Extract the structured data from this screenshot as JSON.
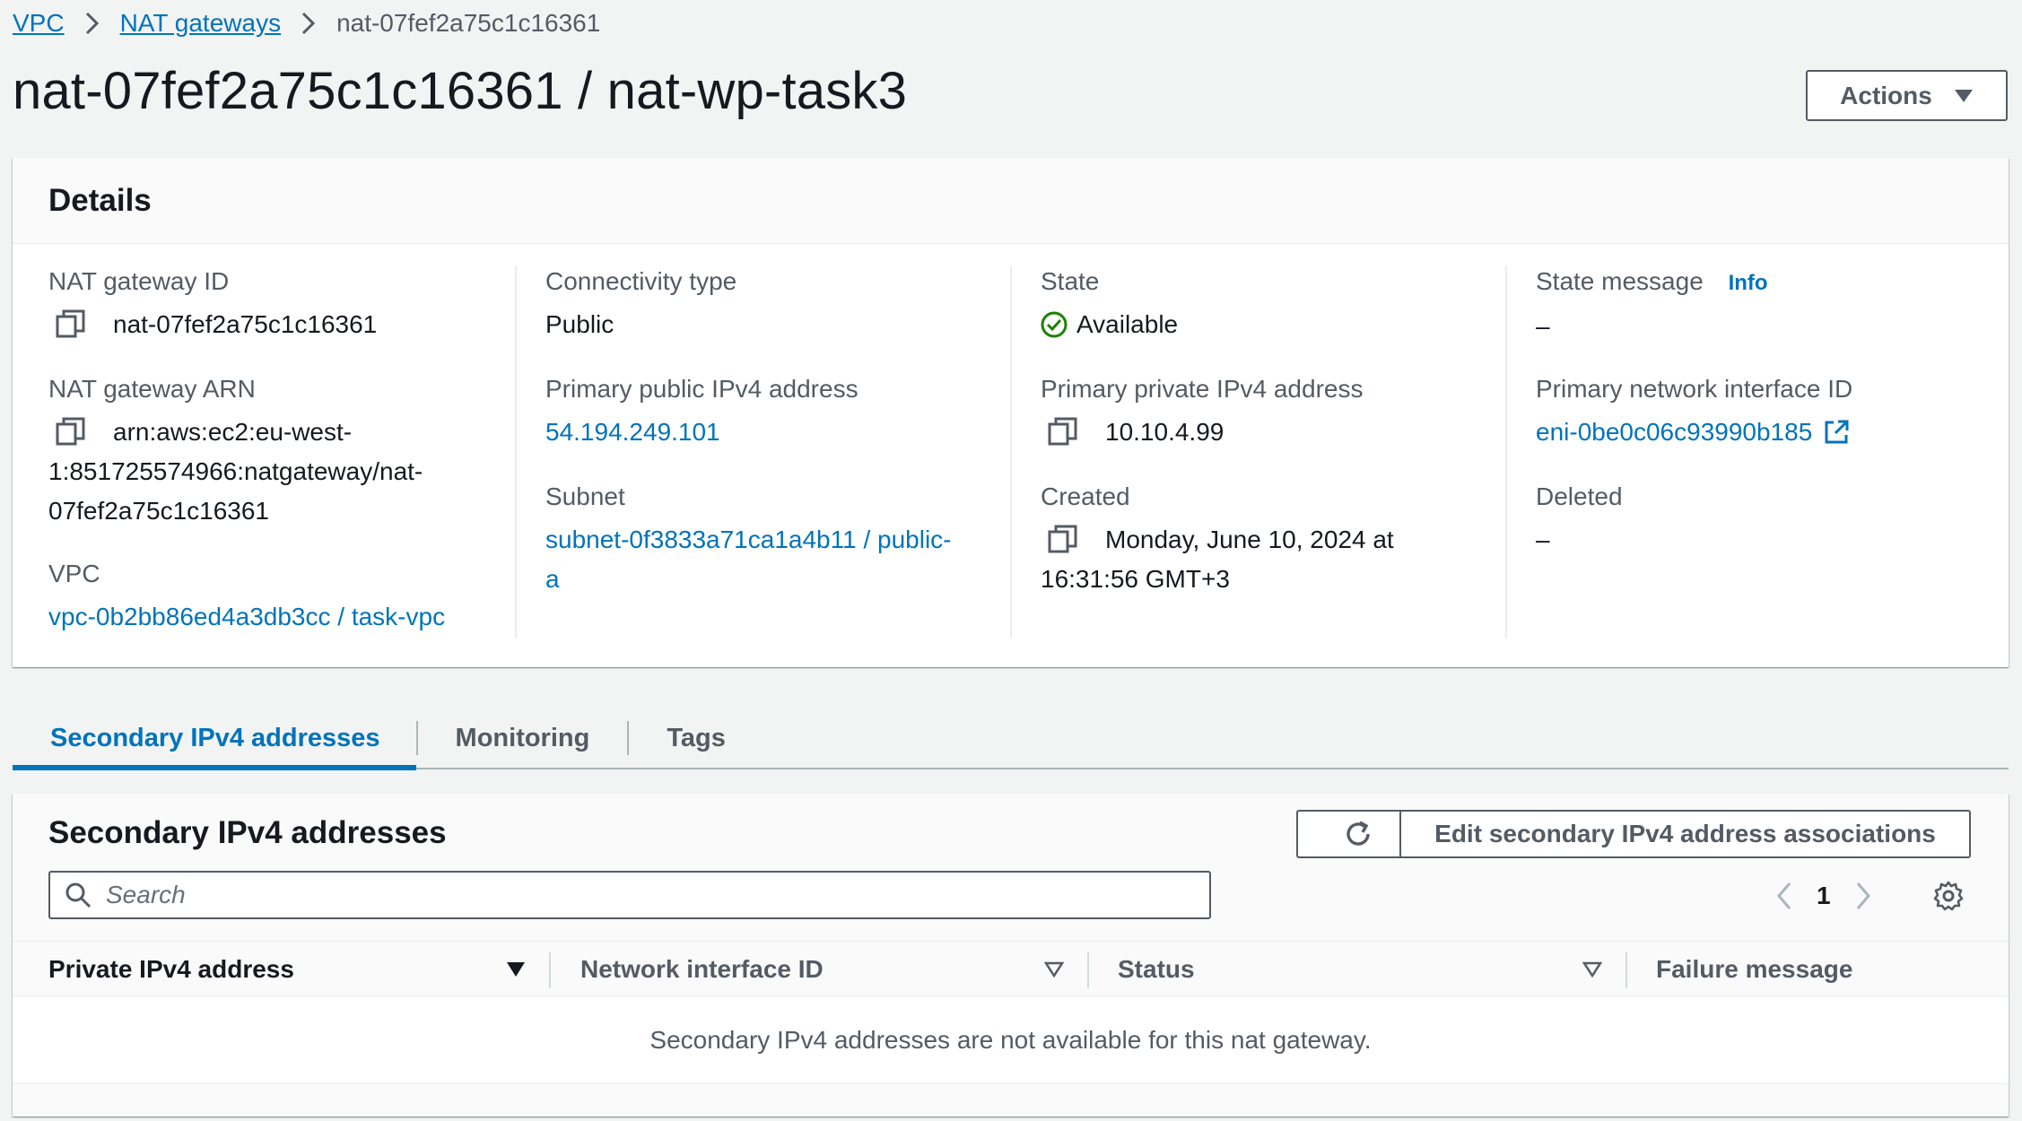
{
  "breadcrumb": {
    "items": [
      "VPC",
      "NAT gateways"
    ],
    "current": "nat-07fef2a75c1c16361"
  },
  "header": {
    "title": "nat-07fef2a75c1c16361 / nat-wp-task3",
    "actions_label": "Actions"
  },
  "details": {
    "title": "Details",
    "nat_gateway_id": {
      "label": "NAT gateway ID",
      "value": "nat-07fef2a75c1c16361"
    },
    "nat_gateway_arn": {
      "label": "NAT gateway ARN",
      "line1": "arn:aws:ec2:eu-west-",
      "line2": "1:851725574966:natgateway/nat-",
      "line3": "07fef2a75c1c16361"
    },
    "vpc": {
      "label": "VPC",
      "value": "vpc-0b2bb86ed4a3db3cc / task-vpc"
    },
    "connectivity_type": {
      "label": "Connectivity type",
      "value": "Public"
    },
    "primary_public_ip": {
      "label": "Primary public IPv4 address",
      "value": "54.194.249.101"
    },
    "subnet": {
      "label": "Subnet",
      "line1": "subnet-0f3833a71ca1a4b11 / public-",
      "line2": "a"
    },
    "state": {
      "label": "State",
      "value": "Available"
    },
    "primary_private_ip": {
      "label": "Primary private IPv4 address",
      "value": "10.10.4.99"
    },
    "created": {
      "label": "Created",
      "line1": "Monday, June 10, 2024 at",
      "line2": "16:31:56 GMT+3"
    },
    "state_message": {
      "label": "State message",
      "info": "Info",
      "value": "–"
    },
    "primary_eni": {
      "label": "Primary network interface ID",
      "value": "eni-0be0c06c93990b185"
    },
    "deleted": {
      "label": "Deleted",
      "value": "–"
    }
  },
  "tabs": [
    {
      "label": "Secondary IPv4 addresses",
      "active": true
    },
    {
      "label": "Monitoring",
      "active": false
    },
    {
      "label": "Tags",
      "active": false
    }
  ],
  "secondary": {
    "title": "Secondary IPv4 addresses",
    "edit_label": "Edit secondary IPv4 address associations",
    "search_placeholder": "Search",
    "page": "1",
    "columns": [
      "Private IPv4 address",
      "Network interface ID",
      "Status",
      "Failure message"
    ],
    "empty_message": "Secondary IPv4 addresses are not available for this nat gateway."
  },
  "colors": {
    "link": "#0073bb",
    "success": "#1d8102",
    "text": "#16191f",
    "muted": "#545b64"
  },
  "icons": [
    "chevron-right-icon",
    "caret-down-icon",
    "copy-icon",
    "check-circle-icon",
    "external-link-icon",
    "refresh-icon",
    "search-icon",
    "chevron-left-icon",
    "gear-icon",
    "sort-caret-icon"
  ]
}
